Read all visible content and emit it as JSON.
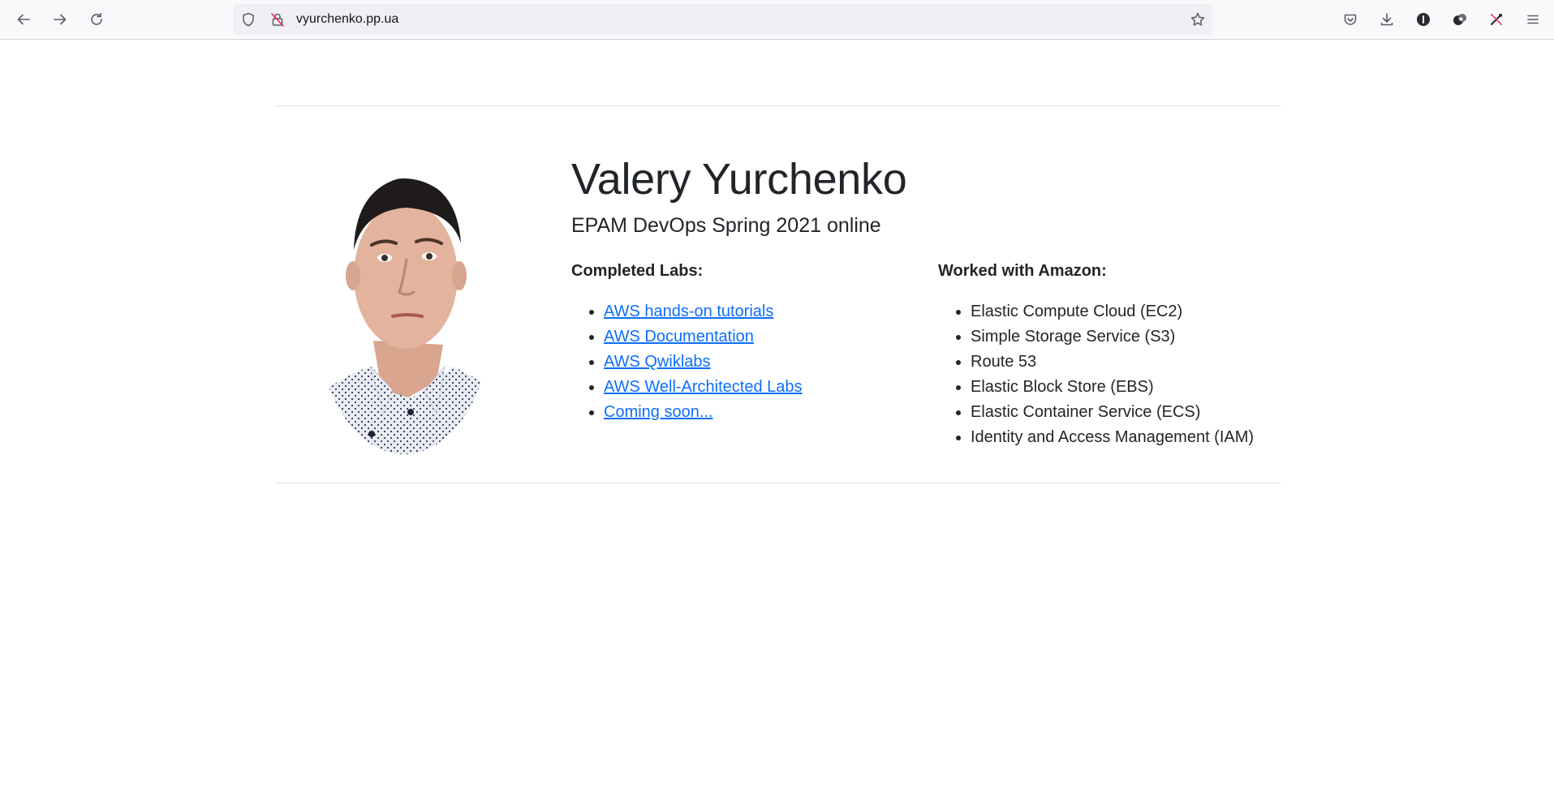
{
  "browser": {
    "url": "vyurchenko.pp.ua",
    "icons": {
      "back": "arrow-left-icon",
      "forward": "arrow-right-icon",
      "reload": "reload-icon",
      "tracking": "shield-icon",
      "permissions": "insecure-lock-icon",
      "bookmark": "star-icon",
      "pocket": "pocket-icon",
      "downloads": "download-icon",
      "extension1": "info-circle-icon",
      "extension2": "extension-icon",
      "extension3": "tools-icon",
      "menu": "hamburger-menu-icon"
    }
  },
  "profile": {
    "name": "Valery Yurchenko",
    "subtitle": "EPAM DevOps Spring 2021 online"
  },
  "labs": {
    "heading": "Completed Labs:",
    "items": [
      "AWS hands-on tutorials",
      "AWS Documentation",
      "AWS Qwiklabs",
      "AWS Well-Architected Labs",
      "Coming soon..."
    ]
  },
  "amazon": {
    "heading": "Worked with Amazon:",
    "items": [
      "Elastic Compute Cloud (EC2)",
      "Simple Storage Service (S3)",
      "Route 53",
      "Elastic Block Store (EBS)",
      "Elastic Container Service (ECS)",
      "Identity and Access Management (IAM)"
    ]
  },
  "colors": {
    "link": "#0d6efd",
    "text": "#212529",
    "toolbar": "#f9f9fb",
    "urlbar": "#f0f0f4"
  }
}
